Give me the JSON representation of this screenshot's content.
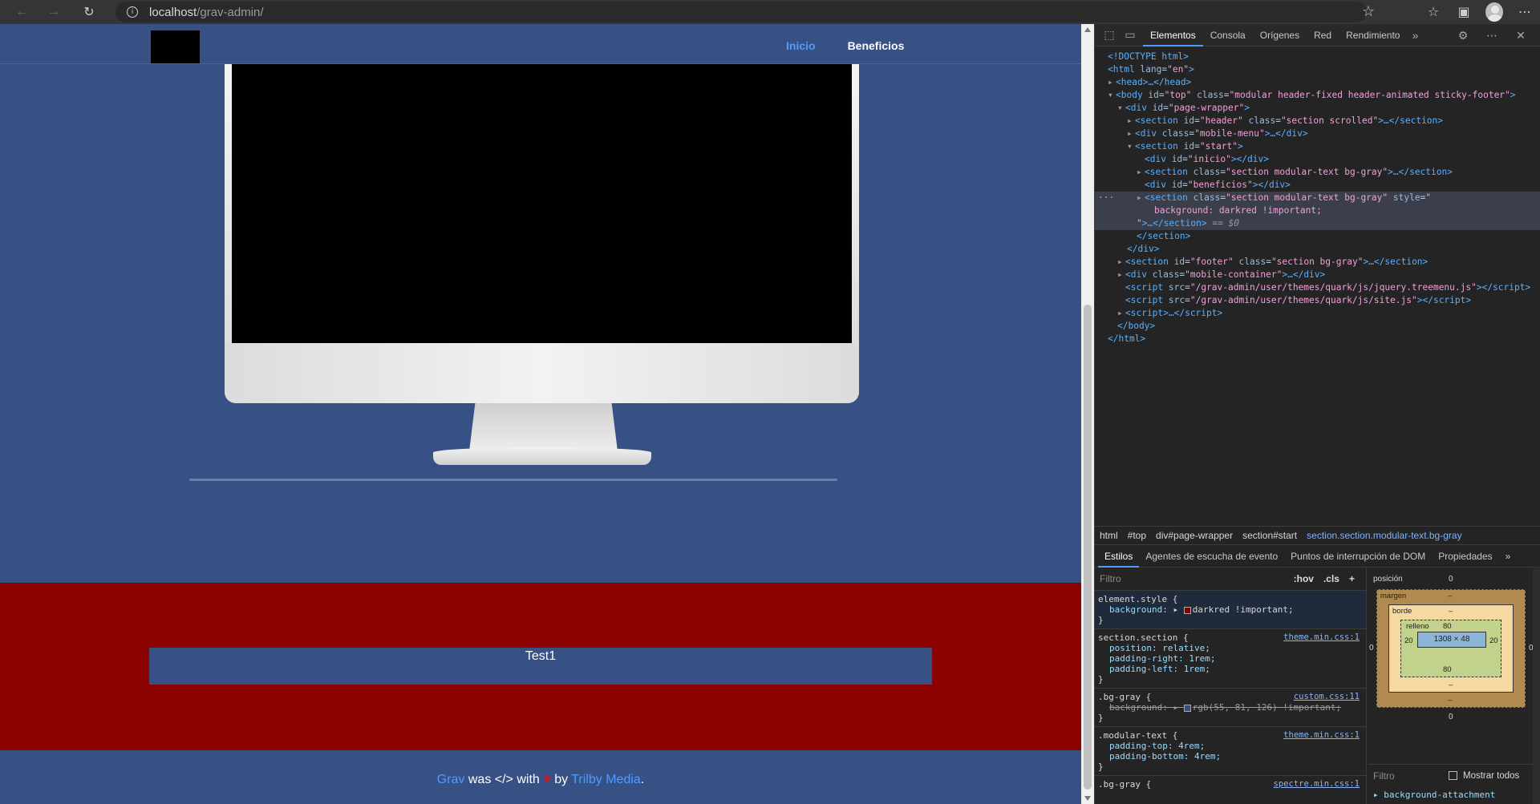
{
  "browser": {
    "url_host": "localhost",
    "url_path": "/grav-admin/"
  },
  "site": {
    "nav": [
      {
        "label": "Inicio",
        "active": true
      },
      {
        "label": "Beneficios",
        "active": false
      }
    ],
    "test_text": "Test1",
    "footer": {
      "grav": "Grav",
      "was": " was ",
      "code": "</>",
      "with": " with ",
      "heart": "♥",
      "by": " by ",
      "trilby": "Trilby Media",
      "end": "."
    }
  },
  "devtools": {
    "tabs": [
      "Elementos",
      "Consola",
      "Orígenes",
      "Red",
      "Rendimiento"
    ],
    "active_tab": "Elementos",
    "breadcrumb": [
      "html",
      "#top",
      "div#page-wrapper",
      "section#start",
      "section.section.modular-text.bg-gray"
    ],
    "styles_tabs": [
      "Estilos",
      "Agentes de escucha de evento",
      "Puntos de interrupción de DOM",
      "Propiedades"
    ],
    "filter_placeholder": "Filtro",
    "hov": ":hov",
    "cls": ".cls",
    "rules": {
      "element_style": {
        "selector": "element.style {",
        "decl": "darkred !important;",
        "color": "#8b0000"
      },
      "section": {
        "selector": "section.section {",
        "src": "theme.min.css:1",
        "decls": [
          "position: relative;",
          "padding-right: 1rem;",
          "padding-left: 1rem;"
        ]
      },
      "bggray": {
        "selector": ".bg-gray {",
        "src": "custom.css:11",
        "decl": "rgb(55, 81, 126) !important;",
        "color": "#37517e"
      },
      "modular": {
        "selector": ".modular-text {",
        "src": "theme.min.css:1",
        "decls": [
          "padding-top: 4rem;",
          "padding-bottom: 4rem;"
        ]
      },
      "bggray2": {
        "selector": ".bg-gray {",
        "src": "spectre.min.css:1"
      }
    },
    "box_model": {
      "position_label": "posición",
      "position_value": "0",
      "margin_label": "margen",
      "margin_value": "–",
      "border_label": "borde",
      "border_value": "–",
      "padding_label": "relleno",
      "padding_top": "80",
      "padding_bottom": "80",
      "padding_left": "20",
      "padding_right": "20",
      "content": "1308 × 48",
      "side": "0",
      "bottom": "0"
    },
    "computed_filter": "Filtro",
    "show_all": "Mostrar todos",
    "computed_first": "background-attachment"
  }
}
